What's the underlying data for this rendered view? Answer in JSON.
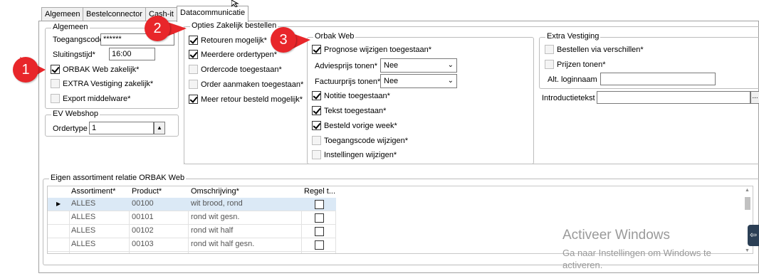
{
  "tabs": [
    "Algemeen",
    "Bestelconnector",
    "Cash-it",
    "Datacommunicatie"
  ],
  "algemeen": {
    "title": "Algemeen",
    "toegangscode_label": "Toegangscode*",
    "toegangscode_value": "******",
    "sluitingstijd_label": "Sluitingstijd*",
    "sluitingstijd_value": "16:00",
    "orbak_web_zakelijk": "ORBAK Web zakelijk*",
    "extra_vestiging_zakelijk": "EXTRA Vestiging zakelijk*",
    "export_middelware": "Export middelware*"
  },
  "ev_webshop": {
    "title": "EV Webshop",
    "ordertype_label": "Ordertype",
    "ordertype_value": "1"
  },
  "opties": {
    "title": "Opties Zakelijk bestellen",
    "retouren_mogelijk": "Retouren mogelijk*",
    "meerdere_ordertypen": "Meerdere ordertypen*",
    "ordercode_toegestaan": "Ordercode toegestaan*",
    "order_aanmaken": "Order aanmaken toegestaan*",
    "meer_retour": "Meer retour besteld mogelijk*"
  },
  "orbak_web": {
    "title": "Orbak Web",
    "prognose": "Prognose wijzigen toegestaan*",
    "adviesprijs_label": "Adviesprijs tonen*",
    "adviesprijs_value": "Nee",
    "factuurprijs_label": "Factuurprijs tonen*",
    "factuurprijs_value": "Nee",
    "notitie": "Notitie  toegestaan*",
    "tekst": "Tekst toegestaan*",
    "besteld_vorige_week": "Besteld vorige week*",
    "toegangscode_wijzigen": "Toegangscode wijzigen*",
    "instellingen_wijzigen": "Instellingen wijzigen*"
  },
  "extra_vestiging": {
    "title": "Extra Vestiging",
    "bestellen_via": "Bestellen via verschillen*",
    "prijzen_tonen": "Prijzen tonen*",
    "alt_login_label": "Alt. loginnaam",
    "introductietekst_label": "Introductietekst",
    "ellipsis": "..."
  },
  "assortiment": {
    "title": "Eigen assortiment relatie ORBAK Web",
    "columns": [
      "Assortiment*",
      "Product*",
      "Omschrijving*",
      "Regel t..."
    ],
    "rows": [
      {
        "assortiment": "ALLES",
        "product": "00100",
        "omschrijving": "wit brood, rond"
      },
      {
        "assortiment": "ALLES",
        "product": "00101",
        "omschrijving": "rond wit gesn."
      },
      {
        "assortiment": "ALLES",
        "product": "00102",
        "omschrijving": "rond wit half"
      },
      {
        "assortiment": "ALLES",
        "product": "00103",
        "omschrijving": "rond wit half gesn."
      }
    ]
  },
  "callouts": [
    "1",
    "2",
    "3"
  ],
  "watermark": {
    "title": "Activeer Windows",
    "subtitle": "Ga naar Instellingen om Windows te activeren."
  },
  "colors": {
    "callout": "#e8262a",
    "selected_row": "#dbe9f6"
  }
}
